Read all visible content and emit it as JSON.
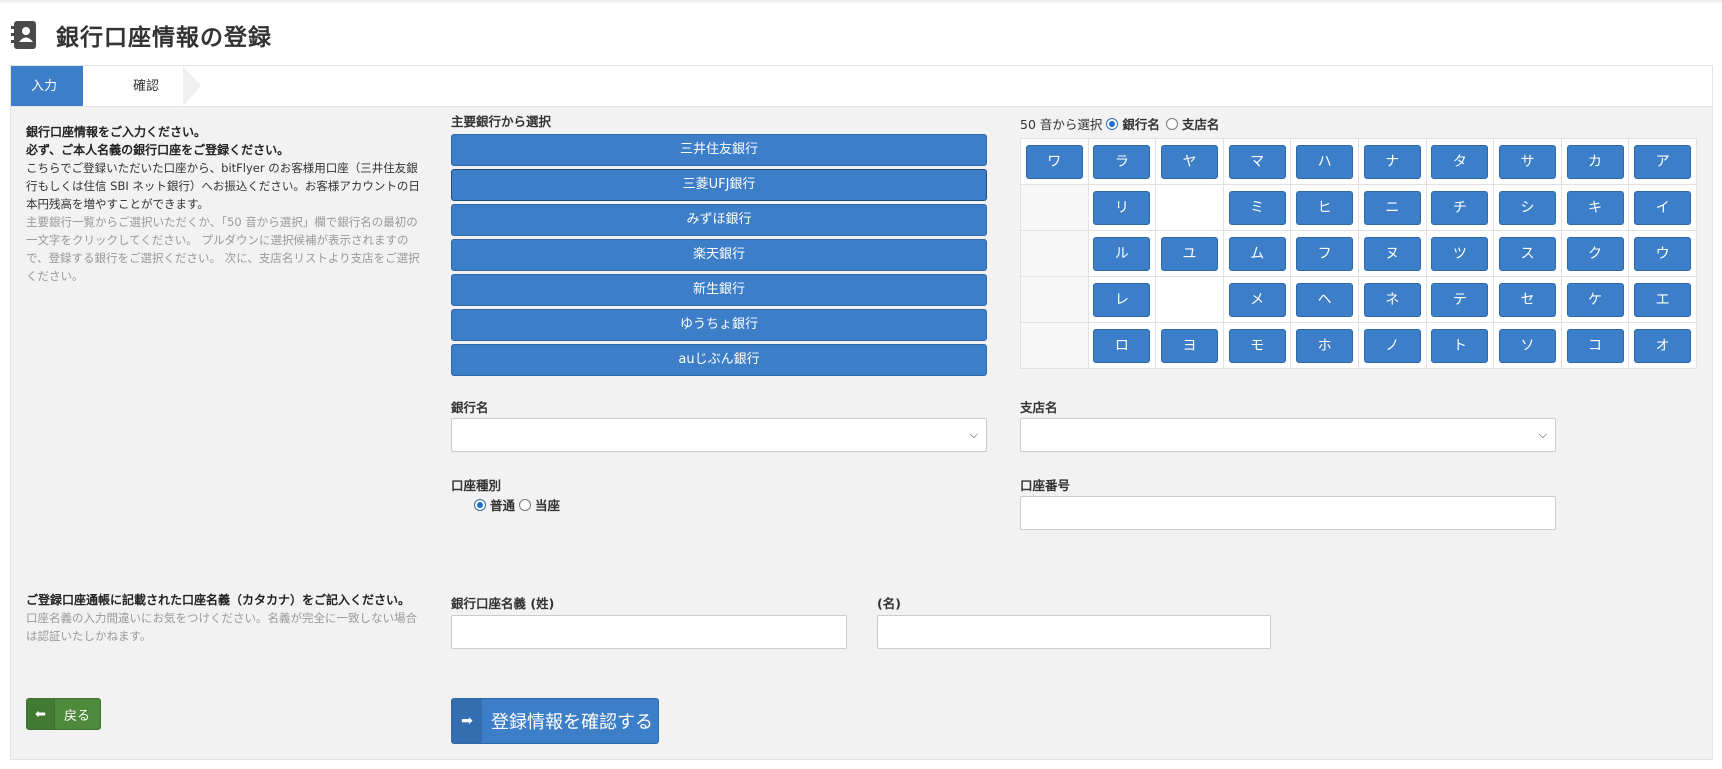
{
  "page_title": "銀行口座情報の登録",
  "steps": [
    "入力",
    "確認"
  ],
  "intro": {
    "bold1": "銀行口座情報をご入力ください。",
    "bold2": "必ず、ご本人名義の銀行口座をご登録ください。",
    "normal": "こちらでご登録いただいた口座から、bitFlyer のお客様用口座（三井住友銀行もしくは住信 SBI ネット銀行）へお振込ください。お客様アカウントの日本円残高を増やすことができます。",
    "gray": "主要銀行一覧からご選択いただくか、「50 音から選択」欄で銀行名の最初の一文字をクリックしてください。 プルダウンに選択候補が表示されますので、登録する銀行をご選択ください。 次に、支店名リストより支店をご選択ください。"
  },
  "major_banks": {
    "label": "主要銀行から選択",
    "items": [
      "三井住友銀行",
      "三菱UFJ銀行",
      "みずほ銀行",
      "楽天銀行",
      "新生銀行",
      "ゆうちょ銀行",
      "auじぶん銀行"
    ]
  },
  "kana_select": {
    "label": "50 音から選択",
    "option_bank": "銀行名",
    "option_branch": "支店名",
    "selected": "銀行名",
    "rows": [
      [
        "ワ",
        "ラ",
        "ヤ",
        "マ",
        "ハ",
        "ナ",
        "タ",
        "サ",
        "カ",
        "ア"
      ],
      [
        "",
        "リ",
        "",
        "ミ",
        "ヒ",
        "ニ",
        "チ",
        "シ",
        "キ",
        "イ"
      ],
      [
        "",
        "ル",
        "ユ",
        "ム",
        "フ",
        "ヌ",
        "ツ",
        "ス",
        "ク",
        "ウ"
      ],
      [
        "",
        "レ",
        "",
        "メ",
        "ヘ",
        "ネ",
        "テ",
        "セ",
        "ケ",
        "エ"
      ],
      [
        "",
        "ロ",
        "ヨ",
        "モ",
        "ホ",
        "ノ",
        "ト",
        "ソ",
        "コ",
        "オ"
      ]
    ]
  },
  "fields": {
    "bank_name_label": "銀行名",
    "bank_name_value": "",
    "branch_name_label": "支店名",
    "branch_name_value": "",
    "account_type_label": "口座種別",
    "account_type_options": [
      "普通",
      "当座"
    ],
    "account_type_selected": "普通",
    "account_number_label": "口座番号",
    "account_number_value": "",
    "holder_last_label": "銀行口座名義 (姓)",
    "holder_last_value": "",
    "holder_first_label": "(名)",
    "holder_first_value": ""
  },
  "holder_note": {
    "bold": "ご登録口座通帳に記載された口座名義（カタカナ）をご記入ください。",
    "gray": "口座名義の入力間違いにお気をつけください。名義が完全に一致しない場合は認証いたしかねます。"
  },
  "buttons": {
    "back": "戻る",
    "confirm": "登録情報を確認する"
  },
  "colors": {
    "primary": "#3d7ec8",
    "back_green": "#4e8a3c",
    "panel_bg": "#f2f2f2"
  }
}
